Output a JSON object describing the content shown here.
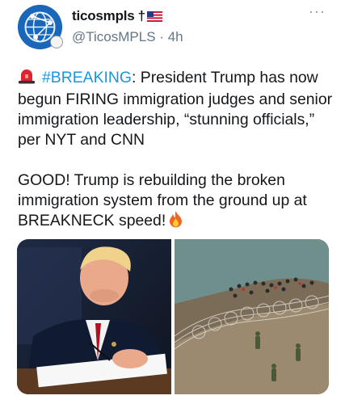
{
  "tweet": {
    "display_name": "ticosmpls",
    "name_symbol": "†",
    "handle": "@TicosMPLS",
    "separator": "·",
    "time": "4h",
    "more_label": "···",
    "hashtag": "#BREAKING",
    "line1_rest": ": President Trump has now begun FIRING immigration judges and senior immigration leadership, “stunning officials,” per NYT and CNN",
    "line2": "GOOD! Trump is rebuilding the broken immigration system from the ground up at BREAKNECK speed!"
  },
  "icons": {
    "siren": "police-light-icon",
    "fire": "fire-emoji-icon",
    "flag": "us-flag-icon",
    "more": "more-options-icon"
  },
  "colors": {
    "hashtag": "#1b95e0",
    "handle": "#657786",
    "text": "#14171a"
  }
}
